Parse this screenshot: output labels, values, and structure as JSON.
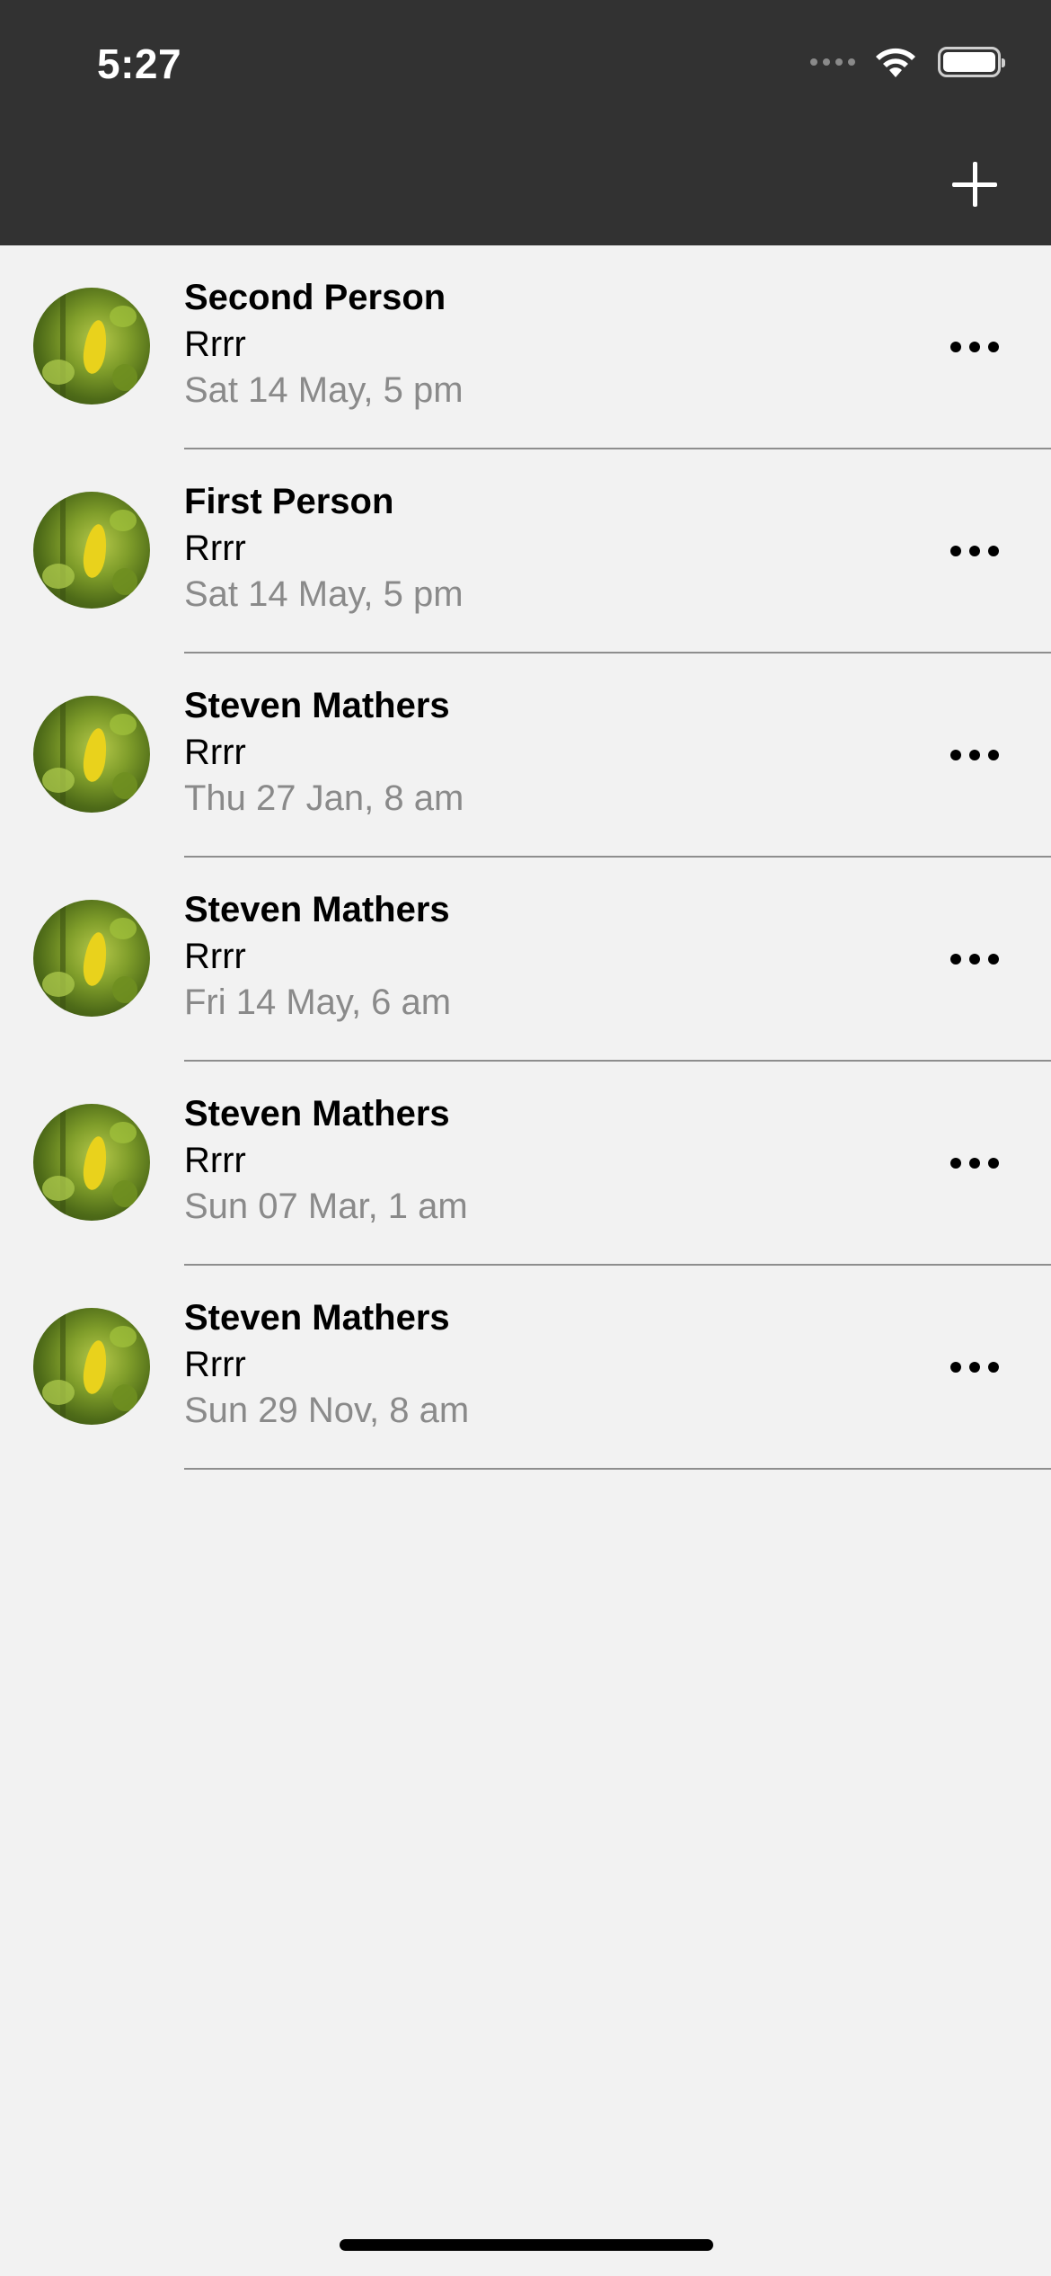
{
  "status_bar": {
    "time": "5:27"
  },
  "toolbar": {
    "add_icon": "plus-icon"
  },
  "entries": [
    {
      "name": "Second Person",
      "subtitle": "Rrrr",
      "date": "Sat 14 May, 5 pm"
    },
    {
      "name": "First Person",
      "subtitle": "Rrrr",
      "date": "Sat 14 May, 5 pm"
    },
    {
      "name": "Steven Mathers",
      "subtitle": "Rrrr",
      "date": "Thu 27 Jan, 8 am"
    },
    {
      "name": "Steven Mathers",
      "subtitle": "Rrrr",
      "date": "Fri 14 May, 6 am"
    },
    {
      "name": "Steven Mathers",
      "subtitle": "Rrrr",
      "date": "Sun 07 Mar, 1 am"
    },
    {
      "name": "Steven Mathers",
      "subtitle": "Rrrr",
      "date": "Sun 29 Nov, 8 am"
    }
  ],
  "colors": {
    "header_bg": "#323232",
    "page_bg": "#f2f2f2",
    "date_text": "#8a8a8a"
  }
}
